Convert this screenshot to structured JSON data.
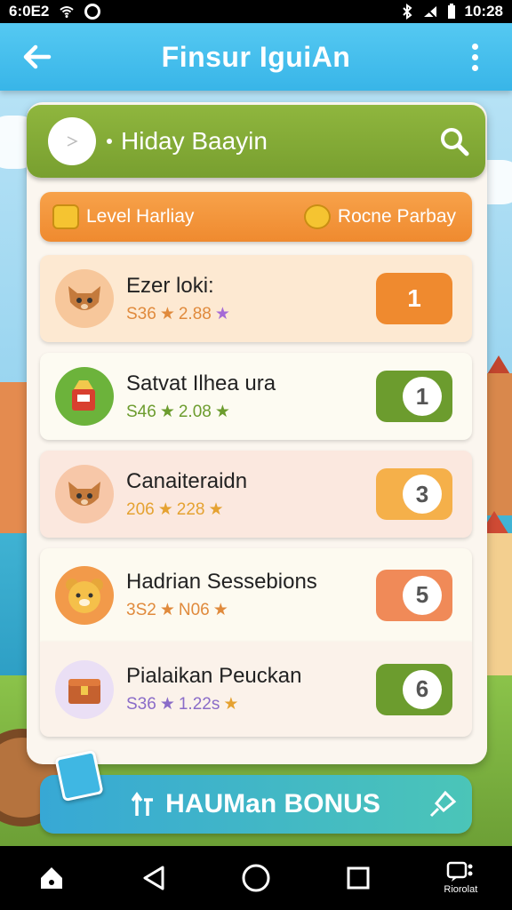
{
  "status_bar": {
    "left_text": "6:0E2",
    "time": "10:28"
  },
  "app_bar": {
    "title": "Finsur IguiAn"
  },
  "search": {
    "query": "Hiday Baayin"
  },
  "filters": [
    {
      "label": "Level Harliay",
      "icon": "treasure-icon"
    },
    {
      "label": "Rocne Parbay",
      "icon": "coin-stack-icon"
    }
  ],
  "items": [
    {
      "name": "Ezer loki:",
      "meta": "S36",
      "rating": "2.88",
      "rank": "1",
      "color": "#ef8a2f",
      "bg": "#fde9d2",
      "icon": "fox-icon"
    },
    {
      "name": "Satvat Ilhea ura",
      "meta": "S46",
      "rating": "2.08",
      "rank": "1",
      "color": "#6c9c2e",
      "bg": "#fdfbf2",
      "icon": "paint-bucket-icon"
    },
    {
      "name": "Canaiteraidn",
      "meta": "206",
      "rating": "228",
      "rank": "3",
      "color": "#f5b04a",
      "bg": "#fbe8df",
      "icon": "fox-icon"
    },
    {
      "name": "Hadrian Sessebions",
      "meta": "3S2",
      "rating": "N06",
      "rank": "5",
      "color": "#f08a58",
      "bg": "#fdfaf0",
      "icon": "bear-icon"
    },
    {
      "name": "Pialaikan Peuckan",
      "meta": "S36",
      "rating": "1.22s",
      "rank": "6",
      "color": "#6c9c2e",
      "bg": "#fbf2ea",
      "icon": "chest-icon"
    }
  ],
  "bonus": {
    "label": "HAUMan BONUS"
  },
  "nav": {
    "recent_label": "Riorolat"
  }
}
